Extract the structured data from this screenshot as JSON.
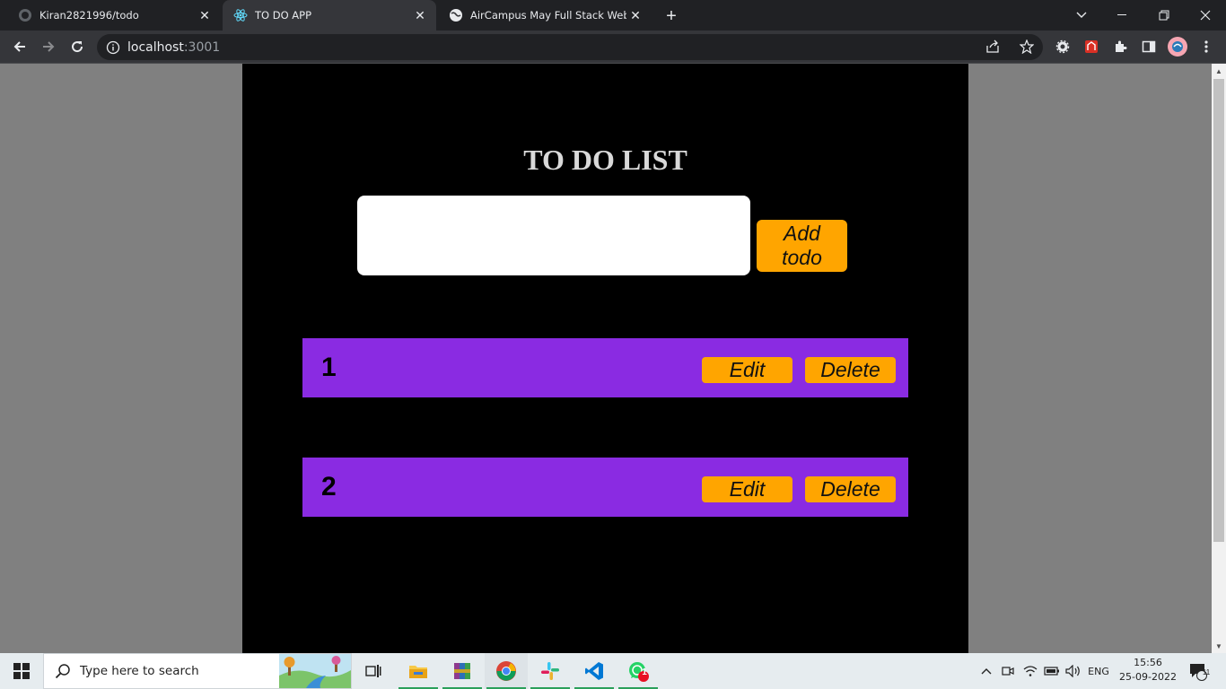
{
  "browser": {
    "tabs": [
      {
        "title": "Kiran2821996/todo",
        "icon": "github-icon"
      },
      {
        "title": "TO DO APP",
        "icon": "react-icon"
      },
      {
        "title": "AirCampus May Full Stack Web D",
        "icon": "globe-icon"
      }
    ],
    "url_host": "localhost",
    "url_port": ":3001"
  },
  "app": {
    "title": "TO DO LIST",
    "input_value": "",
    "add_button_line1": "Add",
    "add_button_line2": "todo",
    "todos": [
      {
        "text": "1",
        "edit_label": "Edit",
        "delete_label": "Delete"
      },
      {
        "text": "2",
        "edit_label": "Edit",
        "delete_label": "Delete"
      }
    ]
  },
  "taskbar": {
    "search_placeholder": "Type here to search",
    "language": "ENG",
    "time": "15:56",
    "date": "25-09-2022",
    "whatsapp_badge": "1",
    "notifications_count": "11"
  },
  "colors": {
    "app_bg": "#000000",
    "todo_bg": "#8a2be2",
    "button_bg": "#ffa500",
    "title_color": "#d9d9d9"
  }
}
